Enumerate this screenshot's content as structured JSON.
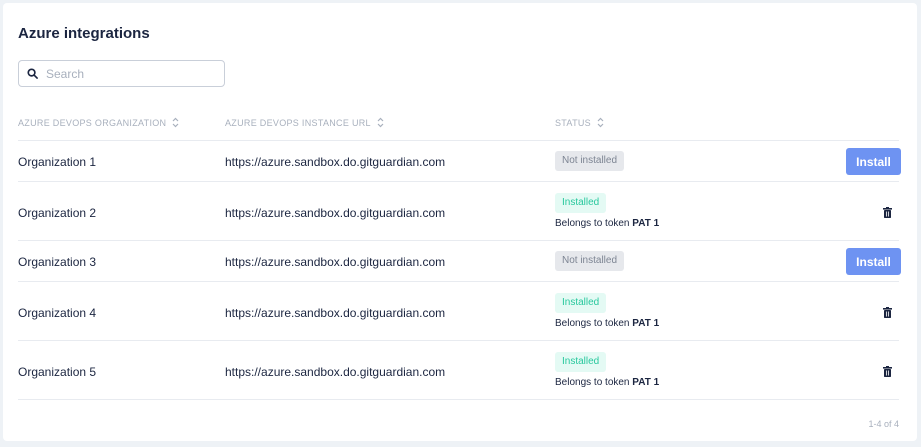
{
  "page": {
    "title": "Azure integrations"
  },
  "search": {
    "placeholder": "Search",
    "value": ""
  },
  "table": {
    "columns": [
      {
        "label": "AZURE DEVOPS ORGANIZATION"
      },
      {
        "label": "AZURE DEVOPS INSTANCE URL"
      },
      {
        "label": "STATUS"
      }
    ],
    "rows": [
      {
        "org": "Organization 1",
        "url": "https://azure.sandbox.do.gitguardian.com",
        "status": "Not installed",
        "action": "Install"
      },
      {
        "org": "Organization 2",
        "url": "https://azure.sandbox.do.gitguardian.com",
        "status": "Installed",
        "token_prefix": "Belongs to token ",
        "token": "PAT 1"
      },
      {
        "org": "Organization 3",
        "url": "https://azure.sandbox.do.gitguardian.com",
        "status": "Not installed",
        "action": "Install"
      },
      {
        "org": "Organization 4",
        "url": "https://azure.sandbox.do.gitguardian.com",
        "status": "Installed",
        "token_prefix": "Belongs to token ",
        "token": "PAT 1"
      },
      {
        "org": "Organization 5",
        "url": "https://azure.sandbox.do.gitguardian.com",
        "status": "Installed",
        "token_prefix": "Belongs to token ",
        "token": "PAT 1"
      }
    ]
  },
  "pagination": {
    "text": "1-4 of 4"
  },
  "colors": {
    "accent": "#6e93f2",
    "installed_text": "#27c89d",
    "installed_bg": "#e4faf4",
    "not_installed_bg": "#e6e8ec",
    "text": "#1b2540"
  },
  "icons": {
    "search": "search-icon",
    "delete": "trash-icon",
    "sort": "sort-icon"
  }
}
